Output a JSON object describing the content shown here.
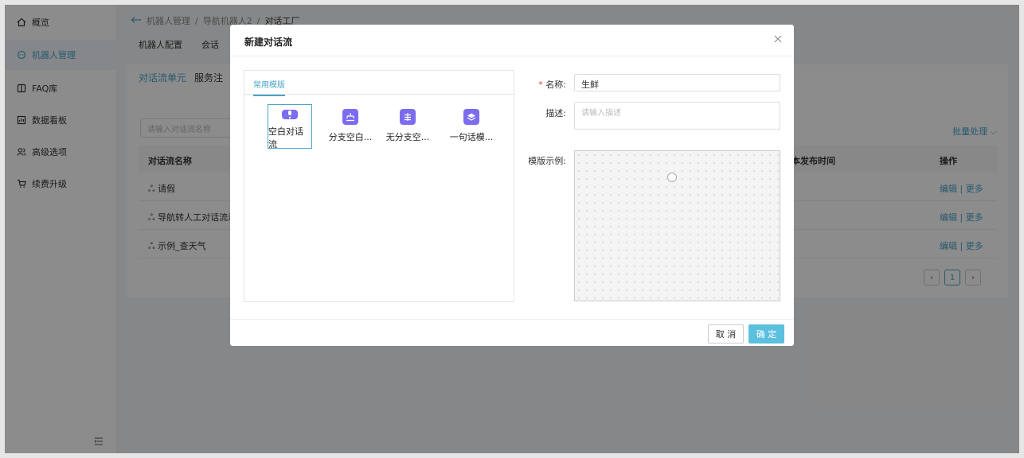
{
  "sidebar": {
    "items": [
      {
        "label": "概览",
        "icon": "home-icon"
      },
      {
        "label": "机器人管理",
        "icon": "robot-icon"
      },
      {
        "label": "FAQ库",
        "icon": "book-icon"
      },
      {
        "label": "数据看板",
        "icon": "dashboard-icon"
      },
      {
        "label": "高级选项",
        "icon": "users-icon"
      },
      {
        "label": "续费升级",
        "icon": "cart-icon"
      }
    ]
  },
  "breadcrumb": {
    "items": [
      "机器人管理",
      "导航机器人2",
      "对话工厂"
    ],
    "sep": "/"
  },
  "topnav": {
    "items": [
      "机器人配置",
      "会话"
    ]
  },
  "panel": {
    "tabs": [
      "对话流单元",
      "服务注"
    ],
    "search_placeholder": "请输入对话流名称",
    "batch_label": "批量处理",
    "headers": {
      "name": "对话流名称",
      "publish_time": "本发布时间",
      "ops": "操作"
    },
    "rows": [
      {
        "name": "请假",
        "ops": "编辑 | 更多"
      },
      {
        "name": "导航转人工对话流示",
        "ops": "编辑 | 更多"
      },
      {
        "name": "示例_查天气",
        "ops": "编辑 | 更多"
      }
    ],
    "page": "1"
  },
  "modal": {
    "title": "新建对话流",
    "templates_tab": "常用模版",
    "templates": [
      {
        "label": "空白对话流",
        "icon": "exclamation-icon",
        "selected": true
      },
      {
        "label": "分支空白...",
        "icon": "branch-icon",
        "selected": false
      },
      {
        "label": "无分支空...",
        "icon": "flow-icon",
        "selected": false
      },
      {
        "label": "一句话模...",
        "icon": "layers-icon",
        "selected": false
      }
    ],
    "name_label": "名称:",
    "name_required": "*",
    "name_value": "生鲜",
    "desc_label": "描述:",
    "desc_placeholder": "请输入描述",
    "preview_label": "模版示例:",
    "cancel": "取 消",
    "ok": "确 定"
  },
  "colors": {
    "accent": "#4aa3c7",
    "badge": "#7b6cf0",
    "ok_button": "#5bc0de"
  }
}
